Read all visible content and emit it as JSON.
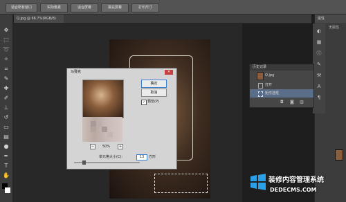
{
  "options_bar": {
    "buttons": [
      "适合所有窗口",
      "实际像素",
      "适合屏幕",
      "填充屏幕",
      "打印尺寸"
    ]
  },
  "document_tab": {
    "label": "Q.jpg @ 66.7%(RGB/8)"
  },
  "right_panel": {
    "tab": "属性",
    "subtitle": "无属性"
  },
  "history_panel": {
    "title": "历史记录",
    "items": [
      {
        "label": "Q.jpg",
        "kind": "snapshot"
      },
      {
        "label": "打开",
        "kind": "step"
      },
      {
        "label": "矩形选框",
        "kind": "step"
      }
    ]
  },
  "mosaic_dialog": {
    "title": "马赛克",
    "ok_label": "确定",
    "cancel_label": "取消",
    "preview_label": "预览(P)",
    "preview_checked": true,
    "zoom_label": "50%",
    "cell_size_label": "单元格大小(C):",
    "cell_size_value": "13",
    "cell_unit": "方形"
  },
  "watermark": {
    "line1": "装修内容管理系统",
    "line2": "DEDECMS.COM"
  },
  "colors": {
    "ui_dark": "#3c3c3c",
    "canvas_bg": "#282828",
    "dialog_bg": "#d4d4d4",
    "accent_blue": "#3b7fd1"
  }
}
